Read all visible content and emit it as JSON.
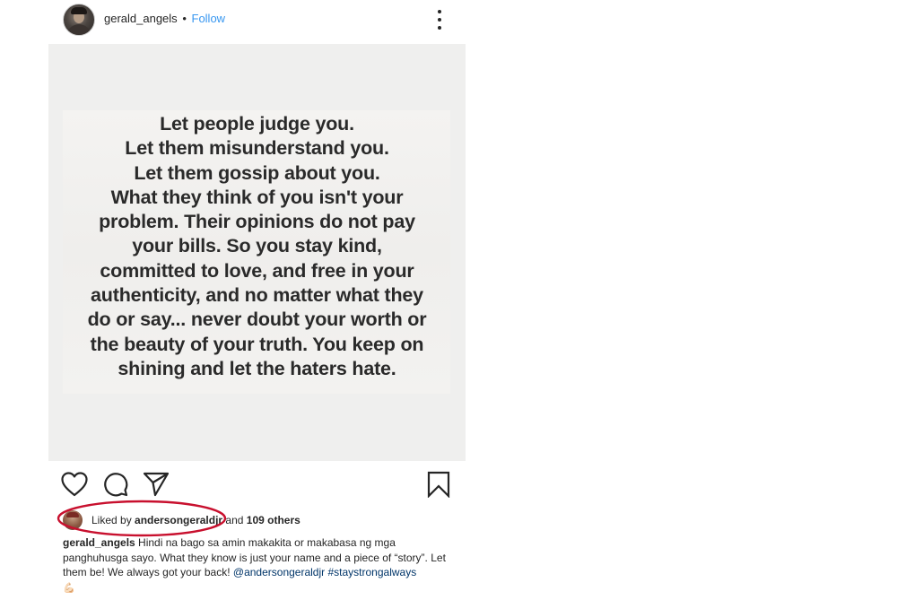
{
  "header": {
    "username": "gerald_angels",
    "separator": "•",
    "follow_label": "Follow"
  },
  "post": {
    "quote_lines": [
      "Let people judge you.",
      "Let them misunderstand you.",
      "Let them gossip about you.",
      "What they think of you isn't your",
      "problem. Their opinions do not pay",
      "your bills. So you stay kind,",
      "committed to love, and free in your",
      "authenticity, and no matter what they",
      "do or say... never doubt your worth or",
      "the beauty of your truth. You keep on",
      "shining and let the haters hate."
    ]
  },
  "likes": {
    "prefix": "Liked by",
    "user": "andersongeraldjr",
    "middle": "and",
    "others": "109 others"
  },
  "caption": {
    "username": "gerald_angels",
    "text": "Hindi na bago sa amin makakita or makabasa ng mga panghuhusga sayo. What they know is just your name and a piece of “story”. Let them be! We always got your back!",
    "mention": "@andersongeraldjr",
    "hashtag": "#staystrongalways",
    "emoji": "💪🏻"
  },
  "icons": [
    "heart-icon",
    "comment-icon",
    "share-icon",
    "bookmark-icon",
    "more-options-icon"
  ],
  "colors": {
    "follow": "#3897f0",
    "highlight_oval": "#c8102e",
    "link": "#003569"
  }
}
